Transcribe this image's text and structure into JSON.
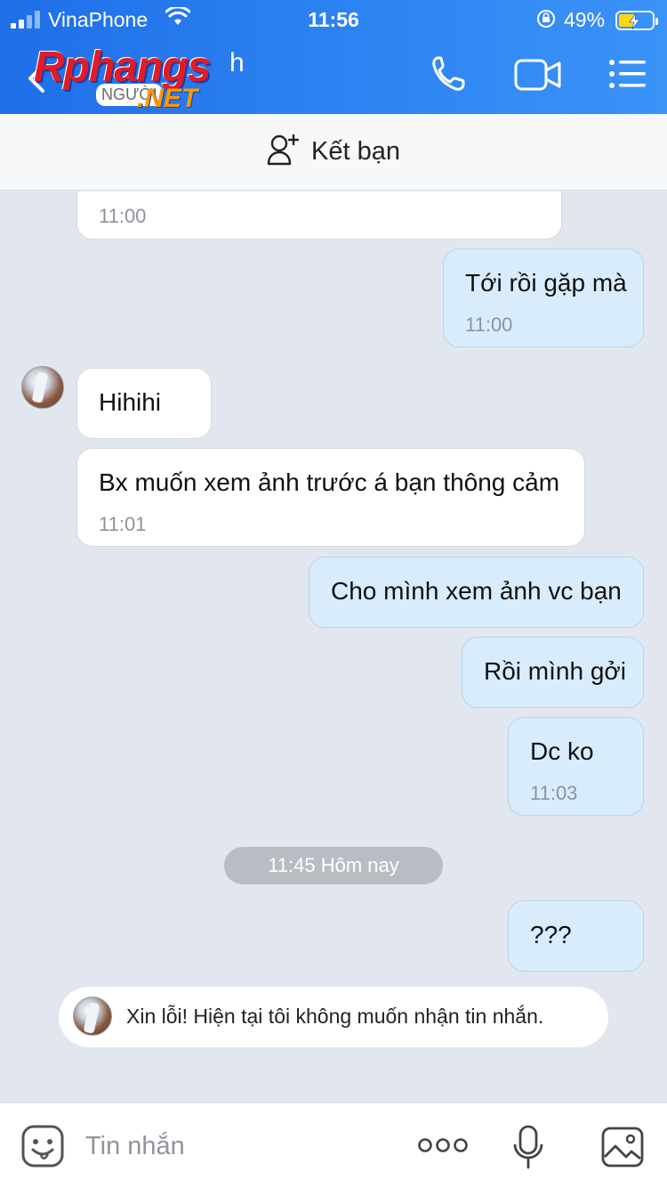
{
  "status_bar": {
    "carrier": "VinaPhone",
    "time": "11:56",
    "battery_pct": "49%",
    "battery_level": 0.49,
    "battery_color": "#ffd60a"
  },
  "header": {
    "logo_brand": "Rphangs",
    "logo_tail": ".NET",
    "logo_tag": "NGƯỜI",
    "name_fragment": "h",
    "icons": [
      "back-icon",
      "phone-icon",
      "video-call-icon",
      "menu-icon"
    ],
    "gradient_colors": [
      "#1f6fe8",
      "#3a93f7"
    ]
  },
  "friend_bar": {
    "label": "Kết bạn",
    "icon": "add-user-icon"
  },
  "messages": [
    {
      "dir": "in",
      "text": "",
      "time": "11:00"
    },
    {
      "dir": "out",
      "text": "Tới rồi gặp mà",
      "time": "11:00"
    },
    {
      "dir": "in",
      "text": "Hihihi",
      "time": ""
    },
    {
      "dir": "in",
      "text": "Bx muốn xem ảnh trước á bạn thông cảm",
      "time": "11:01"
    },
    {
      "dir": "out",
      "text": "Cho mình xem ảnh vc bạn",
      "time": ""
    },
    {
      "dir": "out",
      "text": "Rồi mình gởi",
      "time": ""
    },
    {
      "dir": "out",
      "text": "Dc ko",
      "time": "11:03"
    },
    {
      "dir": "out",
      "text": "???",
      "time": ""
    }
  ],
  "date_separator": "11:45 Hôm nay",
  "notice": "Xin lỗi! Hiện tại tôi không muốn nhận tin nhắn.",
  "input_bar": {
    "placeholder": "Tin nhắn",
    "icons": [
      "emoji-icon",
      "more-icon",
      "microphone-icon",
      "image-icon"
    ]
  },
  "colors": {
    "chat_bg": "#e2e6ee",
    "bubble_out": "#d9ecfc",
    "bubble_in": "#ffffff",
    "timestamp": "#8d939b"
  }
}
